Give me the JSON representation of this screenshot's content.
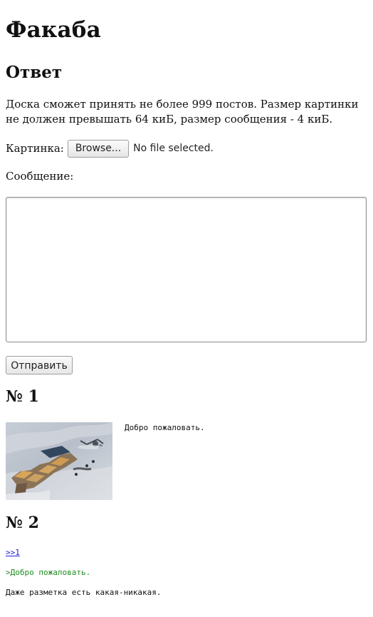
{
  "site": {
    "title": "Факаба"
  },
  "reply_form": {
    "heading": "Ответ",
    "notice": "Доска сможет принять не более 999 постов. Размер картинки не должен превышать 64 киБ, размер сообщения - 4 киБ.",
    "image_label": "Картинка:",
    "browse_label": "Browse...",
    "file_status": "No file selected.",
    "message_label": "Сообщение:",
    "message_value": "",
    "submit_label": "Отправить"
  },
  "posts": [
    {
      "number_label": "№ 1",
      "text": "Добро пожаловать.",
      "thumbnail": "antarctic-station-photo"
    },
    {
      "number_label": "№ 2",
      "reply_link": ">>1",
      "quote": ">Добро пожаловать.",
      "text": "Даже разметка есть какая-никакая."
    }
  ],
  "colors": {
    "background": "#ffffff",
    "text": "#111111",
    "link": "#1f20d8",
    "quote": "#1f8d1f"
  }
}
